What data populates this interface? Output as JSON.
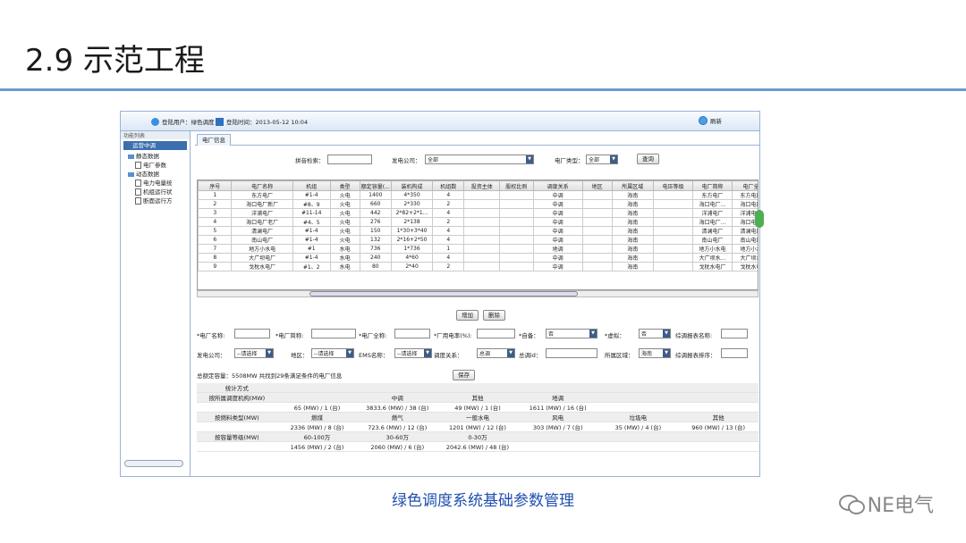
{
  "slide": {
    "title": "2.9 示范工程",
    "caption": "绿色调度系统基础参数管理",
    "brand": "NE电气"
  },
  "topbar": {
    "user_label": "登陆用户：绿色调度",
    "time_label": "登陆时间：2013-05-12 10:04",
    "refresh_label": "刷新"
  },
  "sidebar": {
    "title": "功能列表",
    "home": "运营中调",
    "groups": [
      {
        "label": "静态数据",
        "items": [
          "电厂参数"
        ]
      },
      {
        "label": "动态数据",
        "items": [
          "电力电量统",
          "机组运行状",
          "断面运行方"
        ]
      }
    ]
  },
  "tab": {
    "label": "电厂信息"
  },
  "search": {
    "pinyin_label": "拼音检索：",
    "company_label": "发电公司：",
    "company_value": "全部",
    "type_label": "电厂类型：",
    "type_value": "全部",
    "query_button": "查询"
  },
  "grid": {
    "columns": [
      "序号",
      "电厂名称",
      "机组",
      "类型",
      "额定容量(...",
      "装机构成",
      "机组数",
      "投资主体",
      "股权比例",
      "调度关系",
      "地区",
      "所属区域",
      "电压等级",
      "电厂简称",
      "电厂全"
    ],
    "rows": [
      [
        "1",
        "东方电厂",
        "#1-4",
        "火电",
        "1400",
        "4*350",
        "4",
        "",
        "",
        "中调",
        "",
        "海南",
        "",
        "东方电厂",
        "东方电厂"
      ],
      [
        "2",
        "海口电厂新厂",
        "#8、9",
        "火电",
        "660",
        "2*330",
        "2",
        "",
        "",
        "中调",
        "",
        "海南",
        "",
        "海口电厂...",
        "海口电厂"
      ],
      [
        "3",
        "洋浦电厂",
        "#11-14",
        "火电",
        "442",
        "2*82+2*1...",
        "4",
        "",
        "",
        "中调",
        "",
        "海南",
        "",
        "洋浦电厂",
        "洋浦电厂"
      ],
      [
        "4",
        "海口电厂老厂",
        "#4、5",
        "火电",
        "276",
        "2*138",
        "2",
        "",
        "",
        "中调",
        "",
        "海南",
        "",
        "海口电厂...",
        "海口电厂"
      ],
      [
        "5",
        "清澜电厂",
        "#1-4",
        "火电",
        "150",
        "1*30+3*40",
        "4",
        "",
        "",
        "中调",
        "",
        "海南",
        "",
        "清澜电厂",
        "清澜电厂"
      ],
      [
        "6",
        "南山电厂",
        "#1-4",
        "火电",
        "132",
        "2*16+2*50",
        "4",
        "",
        "",
        "中调",
        "",
        "海南",
        "",
        "南山电厂",
        "南山电厂"
      ],
      [
        "7",
        "地方小水电",
        "#1",
        "水电",
        "736",
        "1*736",
        "1",
        "",
        "",
        "地调",
        "",
        "海南",
        "",
        "地方小水电",
        "地方小水"
      ],
      [
        "8",
        "大广坝电厂",
        "#1-4",
        "水电",
        "240",
        "4*60",
        "4",
        "",
        "",
        "中调",
        "",
        "海南",
        "",
        "大广坝水...",
        "大广坝水"
      ],
      [
        "9",
        "戈枕水电厂",
        "#1、2",
        "水电",
        "80",
        "2*40",
        "2",
        "",
        "",
        "中调",
        "",
        "海南",
        "",
        "戈枕水电厂",
        "戈枕水电"
      ]
    ]
  },
  "actions": {
    "add": "增加",
    "delete": "删除",
    "save": "保存"
  },
  "form": {
    "name_label": "*电厂名称:",
    "short_label": "*电厂简称:",
    "full_label": "*电厂全称:",
    "usage_label": "*厂用电率(%):",
    "self_label": "*自备：",
    "self_value": "否",
    "virtual_label": "*虚拟：",
    "virtual_value": "否",
    "report_name_label": "综调报表名称:",
    "company_label": "发电公司：",
    "company_value": "--请选择",
    "region_label": "地区：",
    "region_value": "--请选择",
    "ems_label": "EMS名称：",
    "ems_value": "--请选择",
    "dispatch_label": "调度关系：",
    "dispatch_value": "总调",
    "dispatch_id_label": "总调id：",
    "area_label": "所属区域：",
    "area_value": "海南",
    "report_order_label": "综调报表排序：",
    "summary": "总额定容量：5508MW 共找到29条满足条件的电厂信息"
  },
  "stats": {
    "header": "统计方式",
    "rows": [
      [
        "按所属调度机构(MW)",
        "",
        "中调",
        "其他",
        "地调",
        "",
        ""
      ],
      [
        "",
        "65 (MW) / 1 (台)",
        "3833.6 (MW) / 38 (台)",
        "49 (MW) / 1 (台)",
        "1611 (MW) / 16 (台)",
        "",
        ""
      ],
      [
        "按燃料类型(MW)",
        "燃煤",
        "燃气",
        "一般水电",
        "风电",
        "垃圾电",
        "其他"
      ],
      [
        "",
        "2336 (MW) / 8 (台)",
        "723.6 (MW) / 12 (台)",
        "1201 (MW) / 12 (台)",
        "303 (MW) / 7 (台)",
        "35 (MW) / 4 (台)",
        "960 (MW) / 13 (台)"
      ],
      [
        "按容量等级(MW)",
        "60-100万",
        "30-60万",
        "0-30万",
        "",
        "",
        ""
      ],
      [
        "",
        "1456 (MW) / 2 (台)",
        "2060 (MW) / 6 (台)",
        "2042.6 (MW) / 48 (台)",
        "",
        "",
        ""
      ]
    ]
  }
}
